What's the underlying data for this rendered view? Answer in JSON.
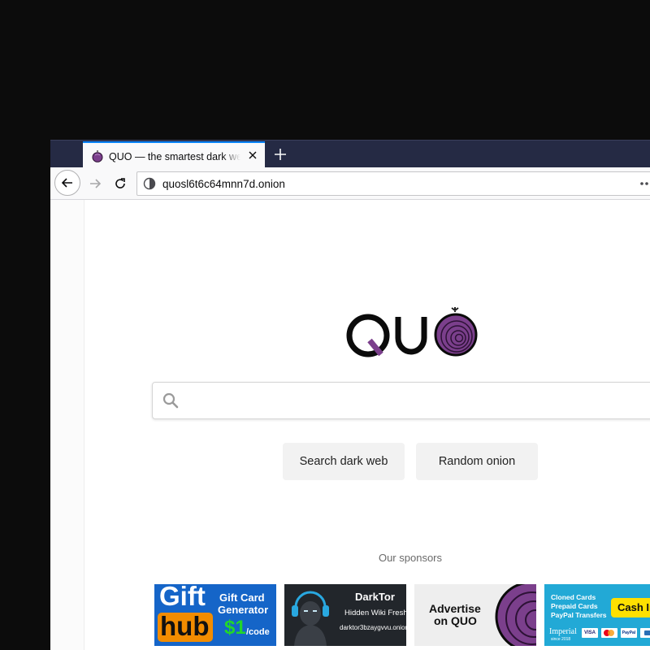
{
  "browser": {
    "tab": {
      "title": "QUO — the smartest dark web search engine",
      "icon": "onion-icon"
    },
    "navbar": {
      "url": "quosl6t6c64mnn7d.onion"
    }
  },
  "page": {
    "logo_text": "QUO",
    "search": {
      "placeholder": ""
    },
    "buttons": {
      "search": "Search dark web",
      "random": "Random onion"
    },
    "sponsors_label": "Our sponsors",
    "ads": [
      {
        "brand_top": "Gift",
        "brand_bottom": "hub",
        "line1": "Gift Card",
        "line2": "Generator",
        "price": "$1",
        "price_unit": "/code"
      },
      {
        "title": "DarkTor",
        "subtitle": "Hidden Wiki Fresh",
        "url": "darktor3bzaygvvu.onion"
      },
      {
        "line1": "Advertise",
        "line2": "on QUO"
      },
      {
        "line1": "Cloned Cards",
        "line2": "Prepaid Cards",
        "line3": "PayPal Transfers",
        "cta": "Cash In",
        "brand": "Imperial",
        "brand_sub": "since 2018",
        "card_labels": [
          "VISA",
          "",
          "PayPal",
          ""
        ]
      }
    ]
  },
  "colors": {
    "tabstrip": "#252a44",
    "accent_purple": "#7b3f8c",
    "gift_orange": "#f28c00",
    "gift_blue": "#1565c8",
    "cash_yellow": "#ffe000"
  }
}
